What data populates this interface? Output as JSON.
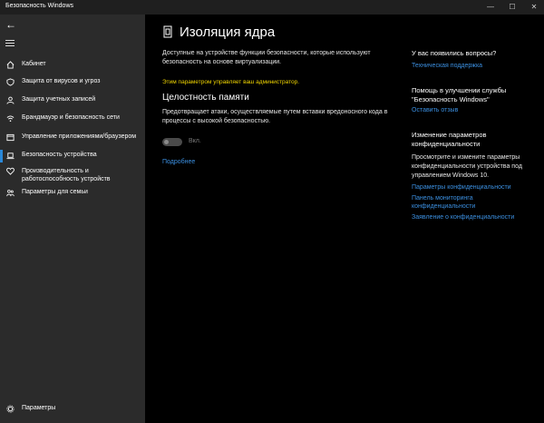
{
  "window": {
    "title": "Безопасность Windows",
    "minimize": "—",
    "maximize": "☐",
    "close": "✕"
  },
  "sidebar": {
    "items": [
      {
        "label": "Кабинет"
      },
      {
        "label": "Защита от вирусов и угроз"
      },
      {
        "label": "Защита учетных записей"
      },
      {
        "label": "Брандмауэр и безопасность сети"
      },
      {
        "label": "Управление приложениями/браузером"
      },
      {
        "label": "Безопасность устройства"
      },
      {
        "label": "Производительность и работоспособность устройств"
      },
      {
        "label": "Параметры для семьи"
      }
    ],
    "settings_label": "Параметры"
  },
  "main": {
    "title": "Изоляция ядра",
    "description": "Доступные на устройстве функции безопасности, которые используют безопасность на основе виртуализации.",
    "admin_notice": "Этим параметром управляет ваш администратор.",
    "section": {
      "title": "Целостность памяти",
      "description": "Предотвращает атаки, осуществляемые путем вставки вредоносного кода в процессы с высокой безопасностью.",
      "toggle_label": "Вкл.",
      "more_link": "Подробнее"
    }
  },
  "right": {
    "questions_title": "У вас появились вопросы?",
    "support_link": "Техническая поддержка",
    "improve_title": "Помощь в улучшении службы \"Безопасность Windows\"",
    "feedback_link": "Оставить отзыв",
    "privacy_title": "Изменение параметров конфиденциальности",
    "privacy_text": "Просмотрите и измените параметры конфиденциальности устройства под управлением Windows 10.",
    "privacy_settings_link": "Параметры конфиденциальности",
    "privacy_dashboard_link": "Панель мониторинга конфиденциальности",
    "privacy_statement_link": "Заявление о конфиденциальности"
  }
}
